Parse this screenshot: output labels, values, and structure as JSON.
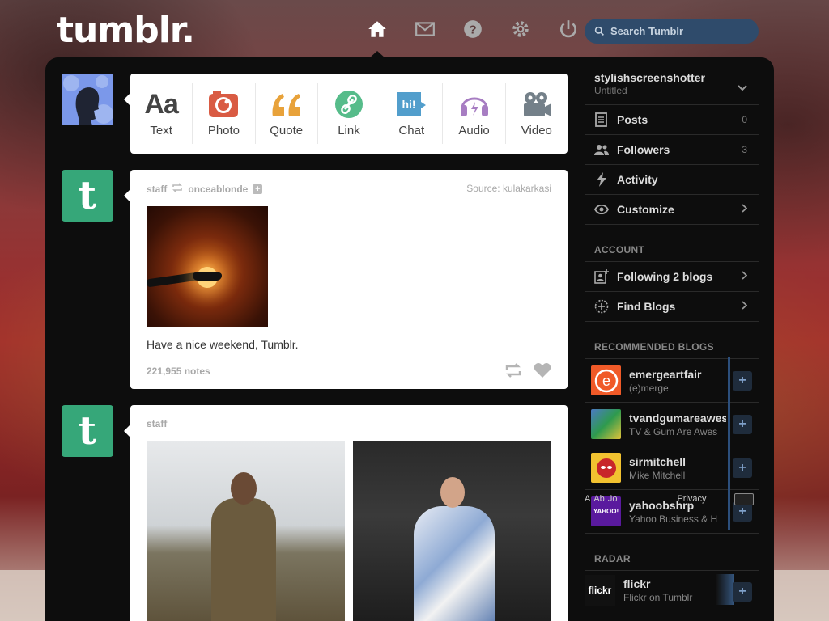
{
  "header": {
    "logo": "tumblr.",
    "nav": [
      "home-icon",
      "mail-icon",
      "help-icon",
      "gear-icon",
      "power-icon"
    ],
    "search_placeholder": "Search Tumblr"
  },
  "composer": {
    "types": [
      {
        "label": "Text",
        "icon": "Aa"
      },
      {
        "label": "Photo",
        "icon": "camera-icon"
      },
      {
        "label": "Quote",
        "icon": "quote-icon"
      },
      {
        "label": "Link",
        "icon": "link-icon"
      },
      {
        "label": "Chat",
        "icon": "hi!"
      },
      {
        "label": "Audio",
        "icon": "headphones-icon"
      },
      {
        "label": "Video",
        "icon": "video-camera-icon"
      }
    ]
  },
  "post1": {
    "author": "staff",
    "reblogged_from": "onceablonde",
    "source_label": "Source:",
    "source": "kulakarkasi",
    "caption": "Have a nice weekend, Tumblr.",
    "notes": "221,955 notes"
  },
  "post2": {
    "author": "staff"
  },
  "sidebar": {
    "blog": {
      "name": "stylishscreenshotter",
      "title": "Untitled"
    },
    "rows": [
      {
        "label": "Posts",
        "count": "0"
      },
      {
        "label": "Followers",
        "count": "3"
      },
      {
        "label": "Activity",
        "count": ""
      },
      {
        "label": "Customize",
        "count": ""
      }
    ],
    "account_heading": "ACCOUNT",
    "account_rows": [
      {
        "label": "Following 2 blogs"
      },
      {
        "label": "Find Blogs"
      }
    ],
    "recommended_heading": "RECOMMENDED BLOGS",
    "recommended": [
      {
        "name": "emergeartfair",
        "sub": "(e)merge"
      },
      {
        "name": "tvandgumareawes",
        "sub": "TV & Gum Are Awes"
      },
      {
        "name": "sirmitchell",
        "sub": "Mike Mitchell"
      },
      {
        "name": "yahoobshrp",
        "sub": "Yahoo Business & H"
      }
    ],
    "yahoo_overlay": [
      "A",
      "Ab",
      "Jo",
      "Privacy"
    ],
    "radar_heading": "RADAR",
    "radar": {
      "name": "flickr",
      "sub": "Flickr on Tumblr",
      "logo": "flickr"
    }
  }
}
